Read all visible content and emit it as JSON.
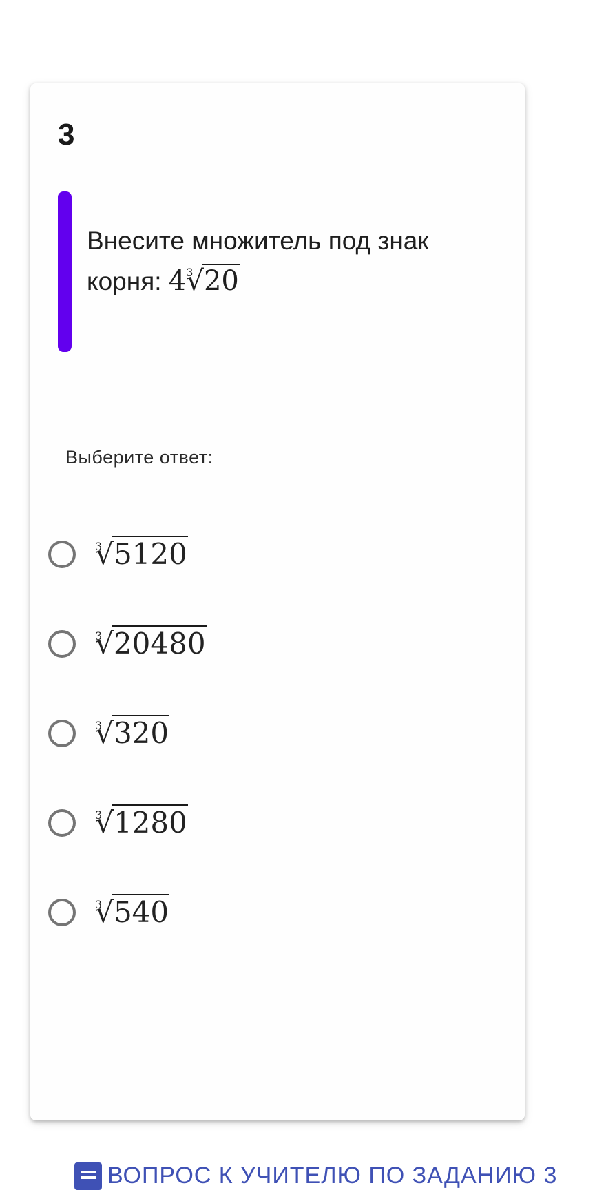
{
  "question": {
    "number": "3",
    "text_prefix": "Внесите множитель под знак корня: ",
    "expression": {
      "coefficient": "4",
      "root_index": "3",
      "radicand": "20"
    }
  },
  "prompt": "Выберите ответ:",
  "options": [
    {
      "root_index": "3",
      "radicand": "5120"
    },
    {
      "root_index": "3",
      "radicand": "20480"
    },
    {
      "root_index": "3",
      "radicand": "320"
    },
    {
      "root_index": "3",
      "radicand": "1280"
    },
    {
      "root_index": "3",
      "radicand": "540"
    }
  ],
  "footer": {
    "link_label": "ВОПРОС К УЧИТЕЛЮ ПО ЗАДАНИЮ 3"
  },
  "colors": {
    "accent": "#6200ee",
    "radio_border": "#757575",
    "link": "#3f51b5"
  }
}
